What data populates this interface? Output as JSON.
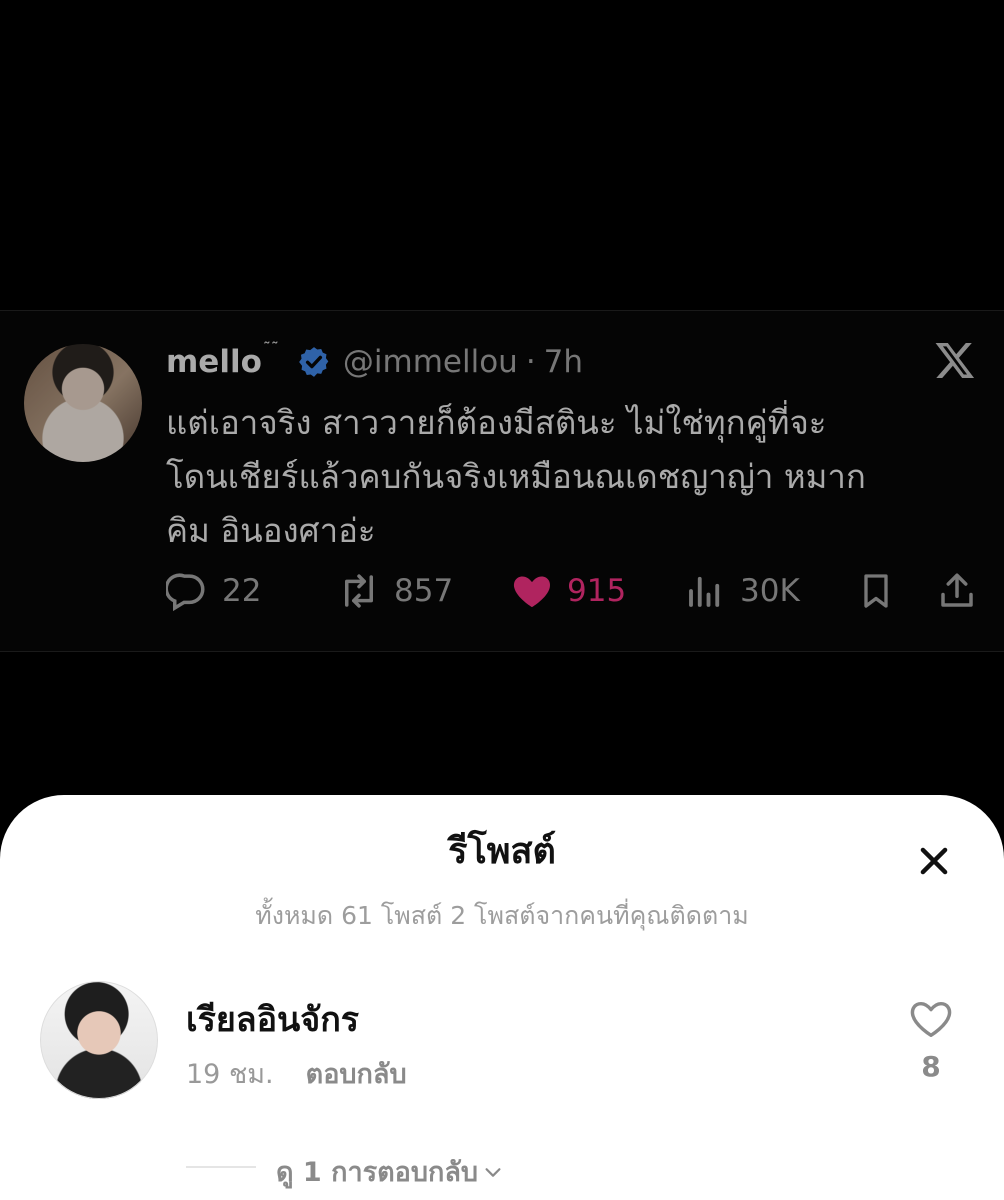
{
  "tweet": {
    "display_name": "mello",
    "name_decoration": "˜˜",
    "handle": "@immellou",
    "separator": "·",
    "time": "7h",
    "text": "แต่เอาจริง สาววายก็ต้องมีสตินะ ไม่ใช่ทุกคู่ที่จะ\nโดนเชียร์แล้วคบกันจริงเหมือนณเดชญาญ่า หมาก\nคิม อินองศาอ่ะ",
    "actions": {
      "replies": "22",
      "reposts": "857",
      "likes": "915",
      "views": "30K"
    },
    "colors": {
      "like": "#b0245f",
      "verified": "#2f62a8"
    }
  },
  "sheet": {
    "title": "รีโพสต์",
    "subtitle": "ทั้งหมด 61 โพสต์ 2 โพสต์จากคนที่คุณติดตาม",
    "reply": {
      "name": "เรียลอินจักร",
      "time": "19 ชม.",
      "reply_label": "ตอบกลับ",
      "likes": "8",
      "view_replies": "ดู 1 การตอบกลับ"
    }
  }
}
